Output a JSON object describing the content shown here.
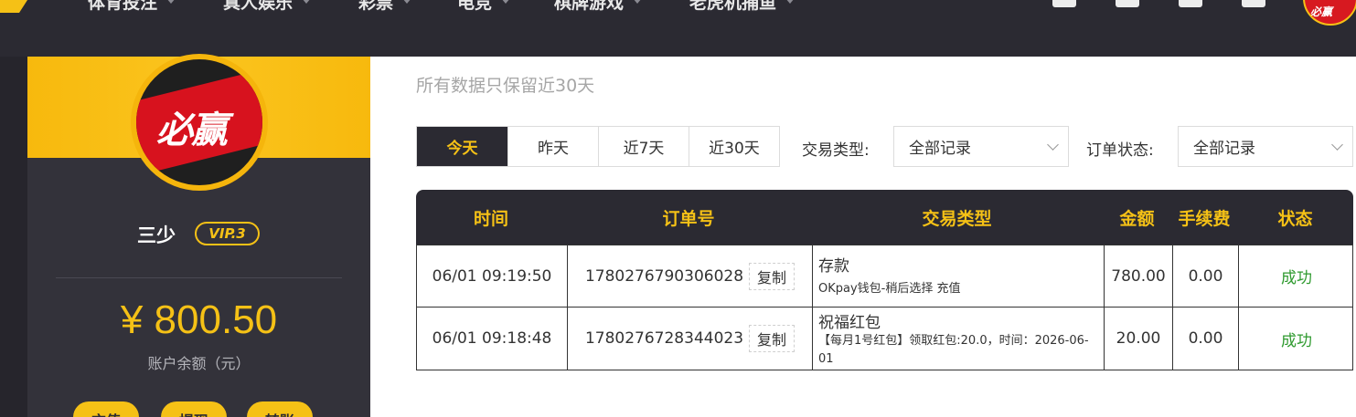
{
  "nav": {
    "items": [
      {
        "label": "体育投注"
      },
      {
        "label": "真人娱乐"
      },
      {
        "label": "彩票"
      },
      {
        "label": "电竞"
      },
      {
        "label": "棋牌游戏"
      },
      {
        "label": "老虎机捕鱼"
      }
    ],
    "icons": [
      "deposit-icon",
      "gift-icon",
      "mail-icon",
      "app-icon"
    ]
  },
  "brand": {
    "logo_text": "必赢"
  },
  "profile": {
    "username": "三少",
    "vip": "VIP.3",
    "balance": "¥ 800.50",
    "balance_label": "账户余额（元）",
    "buttons": [
      "充值",
      "提现",
      "转账"
    ]
  },
  "notice": "所有数据只保留近30天",
  "filters": {
    "tabs": [
      {
        "label": "今天",
        "active": true
      },
      {
        "label": "昨天",
        "active": false
      },
      {
        "label": "近7天",
        "active": false
      },
      {
        "label": "近30天",
        "active": false
      }
    ],
    "type_label": "交易类型:",
    "type_value": "全部记录",
    "status_label": "订单状态:",
    "status_value": "全部记录"
  },
  "table": {
    "headers": [
      "时间",
      "订单号",
      "交易类型",
      "金额",
      "手续费",
      "状态"
    ],
    "copy_label": "复制",
    "rows": [
      {
        "time": "06/01 09:19:50",
        "order_no": "1780276790306028",
        "type": "存款",
        "type_detail": "OKpay钱包-稍后选择 充值",
        "amount": "780.00",
        "fee": "0.00",
        "status": "成功"
      },
      {
        "time": "06/01 09:18:48",
        "order_no": "1780276728344023",
        "type": "祝福红包",
        "type_detail": "【每月1号红包】领取红包:20.0，时间：2026-06-01",
        "amount": "20.00",
        "fee": "0.00",
        "status": "成功"
      }
    ]
  },
  "colors": {
    "accent": "#f5c116",
    "dark": "#2b2a32",
    "success": "#2f9a2f",
    "brand_red": "#d7121e"
  }
}
